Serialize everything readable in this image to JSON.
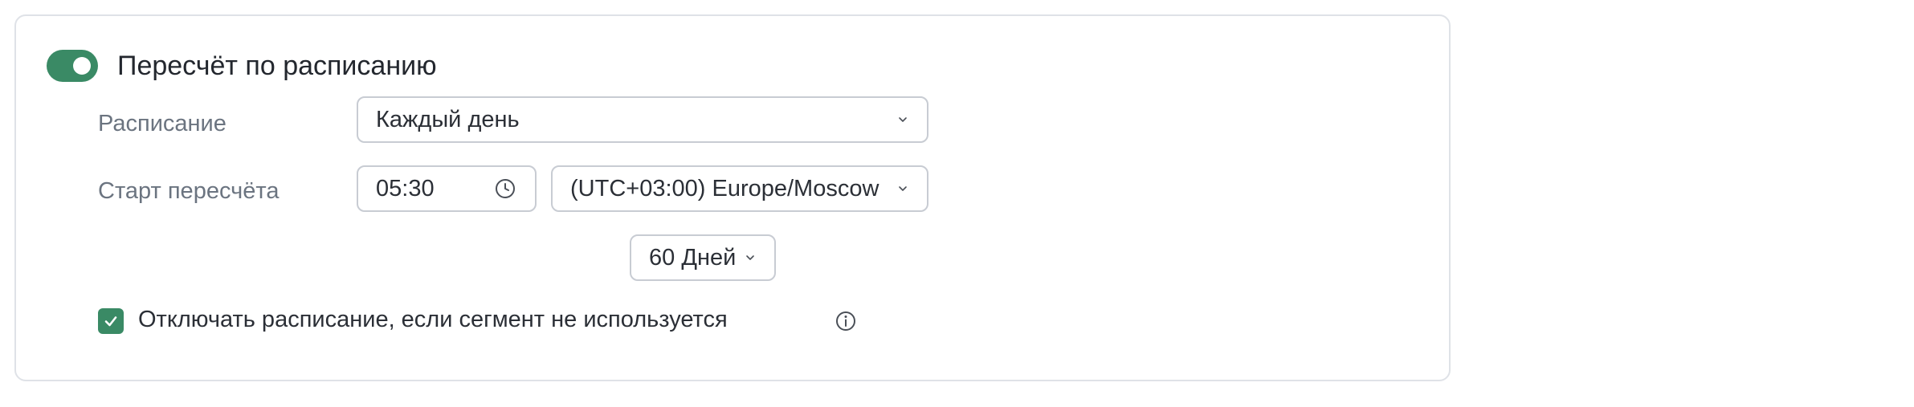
{
  "section": {
    "title": "Пересчёт по расписанию",
    "enabled": true
  },
  "schedule": {
    "label": "Расписание",
    "value": "Каждый день"
  },
  "start": {
    "label": "Старт пересчёта",
    "time": "05:30",
    "timezone": "(UTC+03:00) Europe/Moscow"
  },
  "disable_option": {
    "checked": true,
    "label": "Отключать расписание, если сегмент не используется",
    "period": "60 Дней"
  },
  "colors": {
    "accent": "#3a8a65",
    "border": "#c8ccd3",
    "label": "#6b7480"
  },
  "icons": [
    "chevron-down-icon",
    "clock-icon",
    "check-icon",
    "info-icon"
  ]
}
